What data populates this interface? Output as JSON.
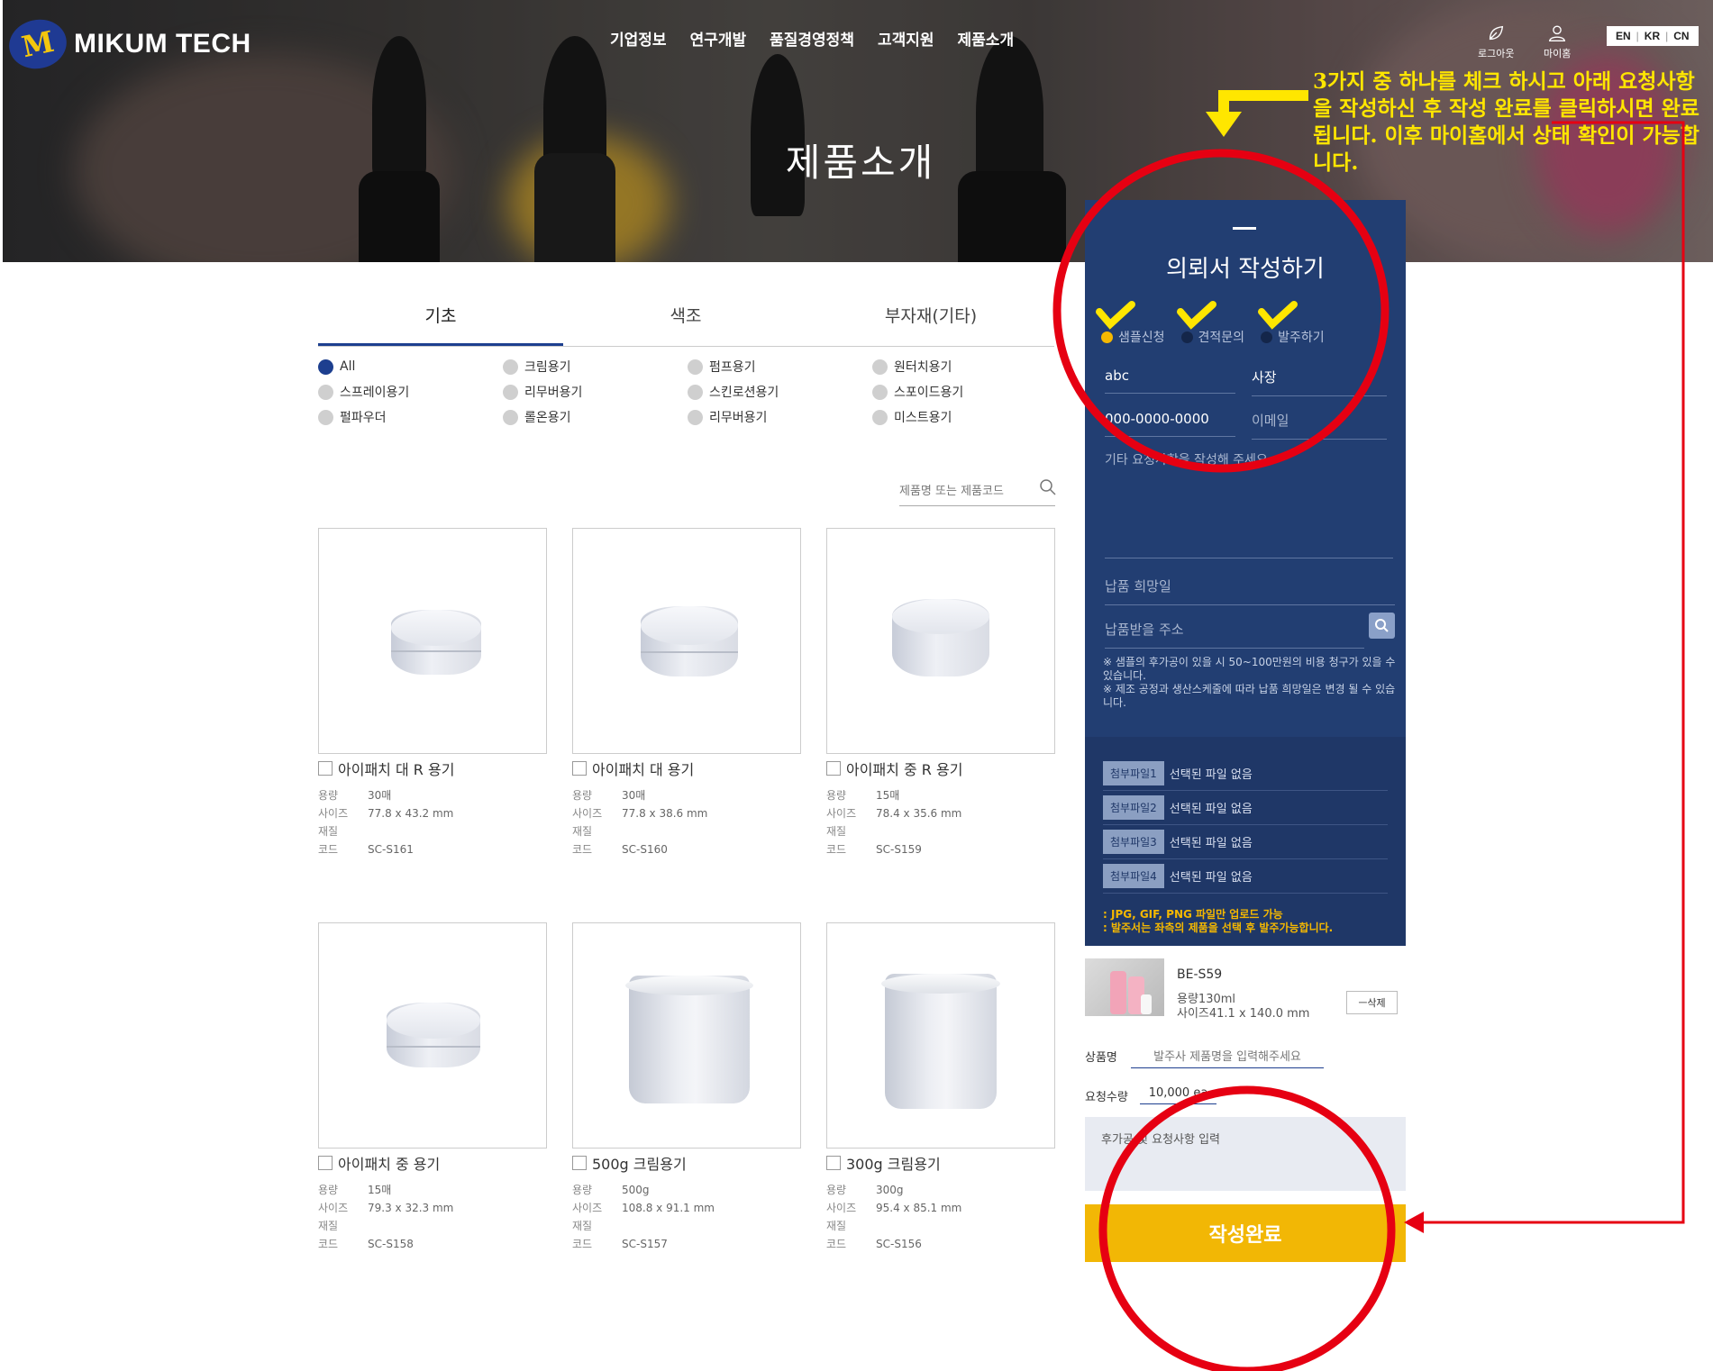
{
  "brand": {
    "logo_mark": "M",
    "name": "MIKUM TECH"
  },
  "nav": [
    "기업정보",
    "연구개발",
    "품질경영정책",
    "고객지원",
    "제품소개"
  ],
  "util": {
    "logout": "로그아웃",
    "mypage": "마이홈"
  },
  "lang": [
    "EN",
    "KR",
    "CN"
  ],
  "hero_title": "제품소개",
  "note": "3가지 중 하나를 체크 하시고 아래 요청사항을 작성하신 후 작성 완료를 클릭하시면 완료됩니다. 이후 마이홈에서 상태 확인이 가능합니다.",
  "tabs": [
    "기초",
    "색조",
    "부자재(기타)"
  ],
  "categories": [
    "All",
    "크림용기",
    "펌프용기",
    "원터치용기",
    "스프레이용기",
    "리무버용기",
    "스킨로션용기",
    "스포이드용기",
    "펄파우더",
    "롤온용기",
    "리무버용기",
    "미스트용기"
  ],
  "search_placeholder": "제품명 또는 제품코드",
  "spec_labels": {
    "cap": "용량",
    "size": "사이즈",
    "material": "재질",
    "code": "코드"
  },
  "products": [
    {
      "name": "아이패치 대 R 용기",
      "cap": "30매",
      "size": "77.8 x 43.2 mm",
      "code": "SC-S161"
    },
    {
      "name": "아이패치 대 용기",
      "cap": "30매",
      "size": "77.8 x 38.6 mm",
      "code": "SC-S160"
    },
    {
      "name": "아이패치 중 R 용기",
      "cap": "15매",
      "size": "78.4 x 35.6 mm",
      "code": "SC-S159"
    },
    {
      "name": "아이패치 중 용기",
      "cap": "15매",
      "size": "79.3 x 32.3 mm",
      "code": "SC-S158"
    },
    {
      "name": "500g 크림용기",
      "cap": "500g",
      "size": "108.8 x 91.1 mm",
      "code": "SC-S157"
    },
    {
      "name": "300g 크림용기",
      "cap": "300g",
      "size": "95.4 x 85.1 mm",
      "code": "SC-S156"
    }
  ],
  "panel": {
    "title": "의뢰서 작성하기",
    "options": [
      "샘플신청",
      "견적문의",
      "발주하기"
    ],
    "company": "abc",
    "position": "사장",
    "phone": "000-0000-0000",
    "email_ph": "이메일",
    "memo_ph": "기타 요청사항을 작성해 주세요",
    "date_ph": "납품 희망일",
    "addr_ph": "납품받을 주소",
    "note1": "※ 샘플의 후가공이 있을 시 50~100만원의 비용 청구가 있을 수 있습니다.",
    "note2": "※ 제조 공정과 생산스케줄에 따라 납품 희망일은 변경 될 수 있습니다.",
    "files": [
      {
        "btn": "첨부파일1",
        "txt": "선택된 파일 없음"
      },
      {
        "btn": "첨부파일2",
        "txt": "선택된 파일 없음"
      },
      {
        "btn": "첨부파일3",
        "txt": "선택된 파일 없음"
      },
      {
        "btn": "첨부파일4",
        "txt": "선택된 파일 없음"
      }
    ],
    "file_note1": ": JPG, GIF, PNG 파일만 업로드 가능",
    "file_note2": ": 발주서는 좌측의 제품을 선택 후 발주가능합니다."
  },
  "selected": {
    "code": "BE-S59",
    "cap": "용량130ml",
    "size": "사이즈41.1 x 140.0 mm",
    "delete": "ㅡ삭제"
  },
  "order": {
    "name_label": "상품명",
    "name_ph": "발주사 제품명을 입력해주세요",
    "qty_label": "요청수량",
    "qty_value": "10,000 ea",
    "req_ph": "후가공 및 요청사항 입력",
    "submit": "작성완료"
  },
  "colors": {
    "navy": "#223e72",
    "accent": "#f2b705",
    "annotation_red": "#e60012",
    "annotation_yellow": "#ffe600"
  }
}
